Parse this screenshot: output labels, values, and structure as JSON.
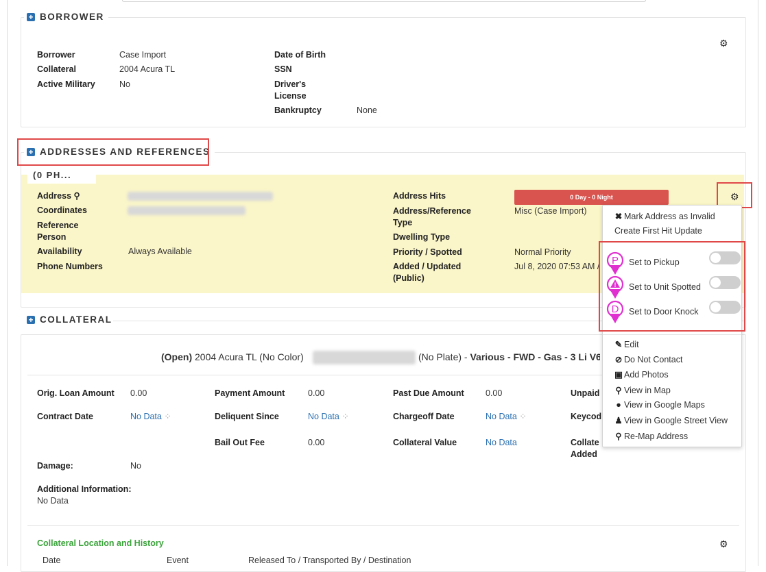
{
  "borrower": {
    "title": "BORROWER",
    "left": [
      {
        "label": "Borrower",
        "value": "Case Import"
      },
      {
        "label": "Collateral",
        "value": "2004 Acura TL"
      },
      {
        "label": "Active Military",
        "value": "No"
      }
    ],
    "right": {
      "dob_label": "Date of Birth",
      "ssn_label": "SSN",
      "license_label": "Driver's License",
      "license_l1": "Driver's",
      "license_l2": "License",
      "bankruptcy_label": "Bankruptcy",
      "bankruptcy_value": "None"
    }
  },
  "addresses": {
    "title": "ADDRESSES AND REFERENCES",
    "card_tab": "(0 PH...",
    "address_label": "Address",
    "coordinates_label": "Coordinates",
    "reference_l1": "Reference",
    "reference_l2": "Person",
    "availability_label": "Availability",
    "availability_value": "Always Available",
    "phone_label": "Phone Numbers",
    "hits_label": "Address Hits",
    "hits_bar": "0 Day - 0 Night",
    "type_l1": "Address/Reference",
    "type_l2": "Type",
    "type_value": "Misc (Case Import)",
    "dwelling_label": "Dwelling Type",
    "priority_label": "Priority / Spotted",
    "priority_value": "Normal Priority",
    "added_l1": "Added / Updated",
    "added_l2": "(Public)",
    "added_value": "Jul 8, 2020 07:53 AM /"
  },
  "menu": {
    "mark_invalid": "Mark Address as Invalid",
    "first_hit": "Create First Hit Update",
    "toggles": [
      {
        "label": "Set to Pickup",
        "letter": "P",
        "on": false
      },
      {
        "label": "Set to Unit Spotted",
        "letter": "!",
        "on": false
      },
      {
        "label": "Set to Door Knock",
        "letter": "D",
        "on": false
      }
    ],
    "edit": "Edit",
    "do_not_contact": "Do Not Contact",
    "add_photos": "Add Photos",
    "view_map": "View in Map",
    "google_maps": "View in Google Maps",
    "street_view": "View in Google Street View",
    "remap": "Re-Map Address"
  },
  "collateral": {
    "title": "COLLATERAL",
    "status": "(Open)",
    "vehicle": "2004 Acura TL (No Color)",
    "plate": "(No Plate) -",
    "specs": "Various - FWD - Gas - 3 Li V6",
    "orig_loan_label": "Orig. Loan Amount",
    "orig_loan_value": "0.00",
    "payment_label": "Payment Amount",
    "payment_value": "0.00",
    "past_due_label": "Past Due Amount",
    "past_due_value": "0.00",
    "unpaid_label": "Unpaid",
    "contract_label": "Contract Date",
    "contract_value": "No Data",
    "delinquent_label": "Deliquent Since",
    "delinquent_value": "No Data",
    "chargeoff_label": "Chargeoff Date",
    "chargeoff_value": "No Data",
    "keycode_label": "Keycod",
    "bailout_label": "Bail Out Fee",
    "bailout_value": "0.00",
    "coll_value_label": "Collateral Value",
    "coll_value_value": "No Data",
    "coll_added_l1": "Collate",
    "coll_added_l2": "Added",
    "damage_label": "Damage:",
    "damage_value": "No",
    "additional_label": "Additional Information:",
    "additional_value": "No Data",
    "location_title": "Collateral Location and History",
    "table_headers": [
      "Date",
      "Event",
      "Released To / Transported By / Destination"
    ]
  },
  "colors": {
    "accent_blue": "#2a6fb0",
    "hits_red": "#d9534f",
    "highlight_yellow": "#fbf6c9",
    "pin_magenta": "#e030d0",
    "location_green": "#3aa33a",
    "annotation_red": "#e04848"
  }
}
